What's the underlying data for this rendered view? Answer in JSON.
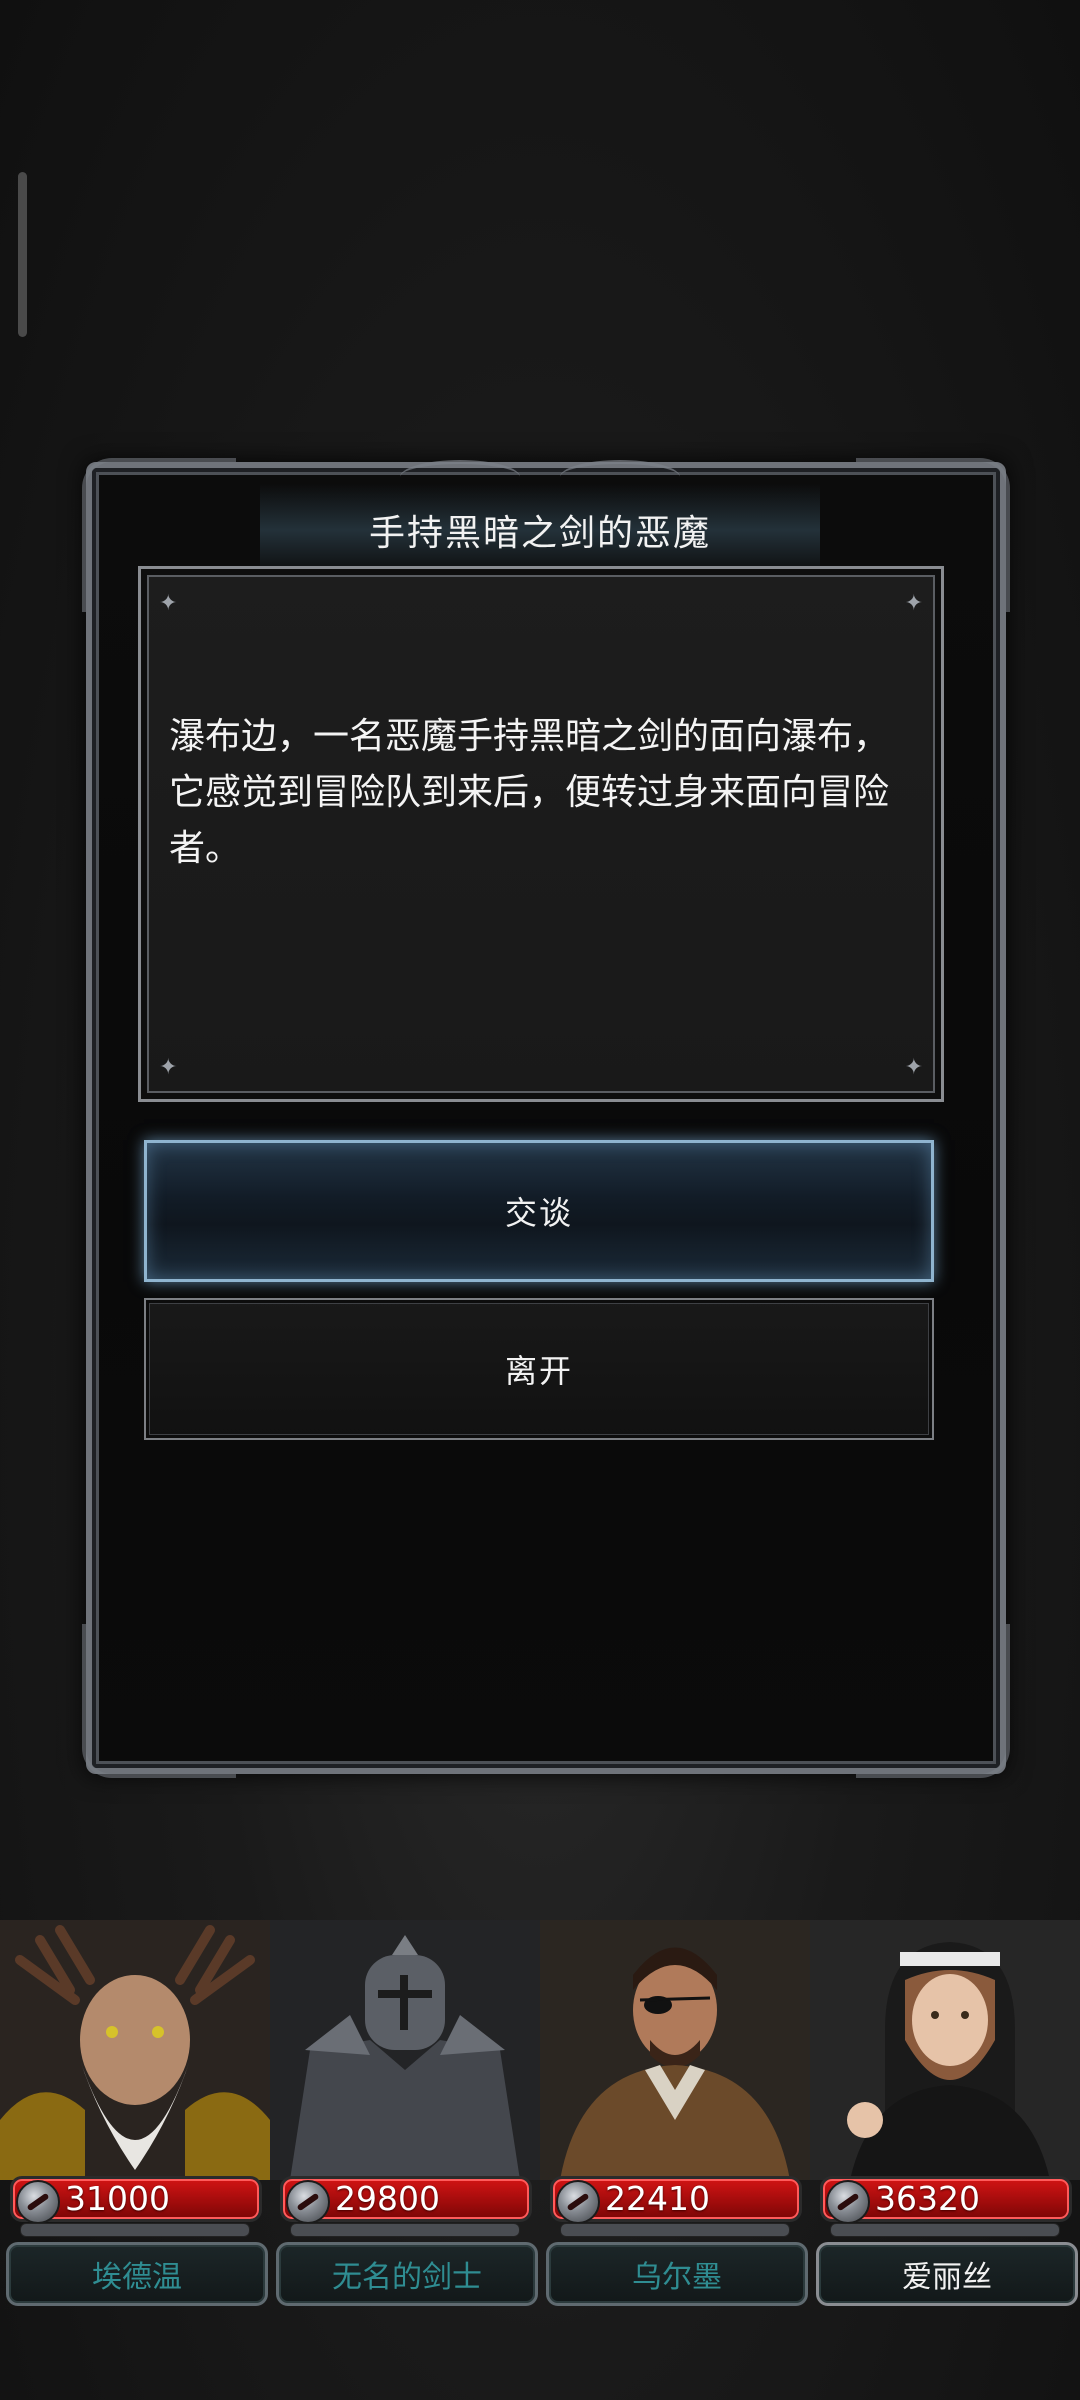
{
  "event": {
    "title": "手持黑暗之剑的恶魔",
    "description": "瀑布边，一名恶魔手持黑暗之剑的面向瀑布，它感觉到冒险队到来后，便转过身来面向冒险者。",
    "options": [
      {
        "label": "交谈"
      },
      {
        "label": "离开"
      }
    ]
  },
  "party": [
    {
      "name": "埃德温",
      "hp": "31000"
    },
    {
      "name": "无名的剑士",
      "hp": "29800"
    },
    {
      "name": "乌尔墨",
      "hp": "22410"
    },
    {
      "name": "爱丽丝",
      "hp": "36320"
    }
  ],
  "colors": {
    "hp_bar": "#b50f0f",
    "name_inactive": "#2f8d92",
    "option_highlight": "#8fb4cf"
  }
}
